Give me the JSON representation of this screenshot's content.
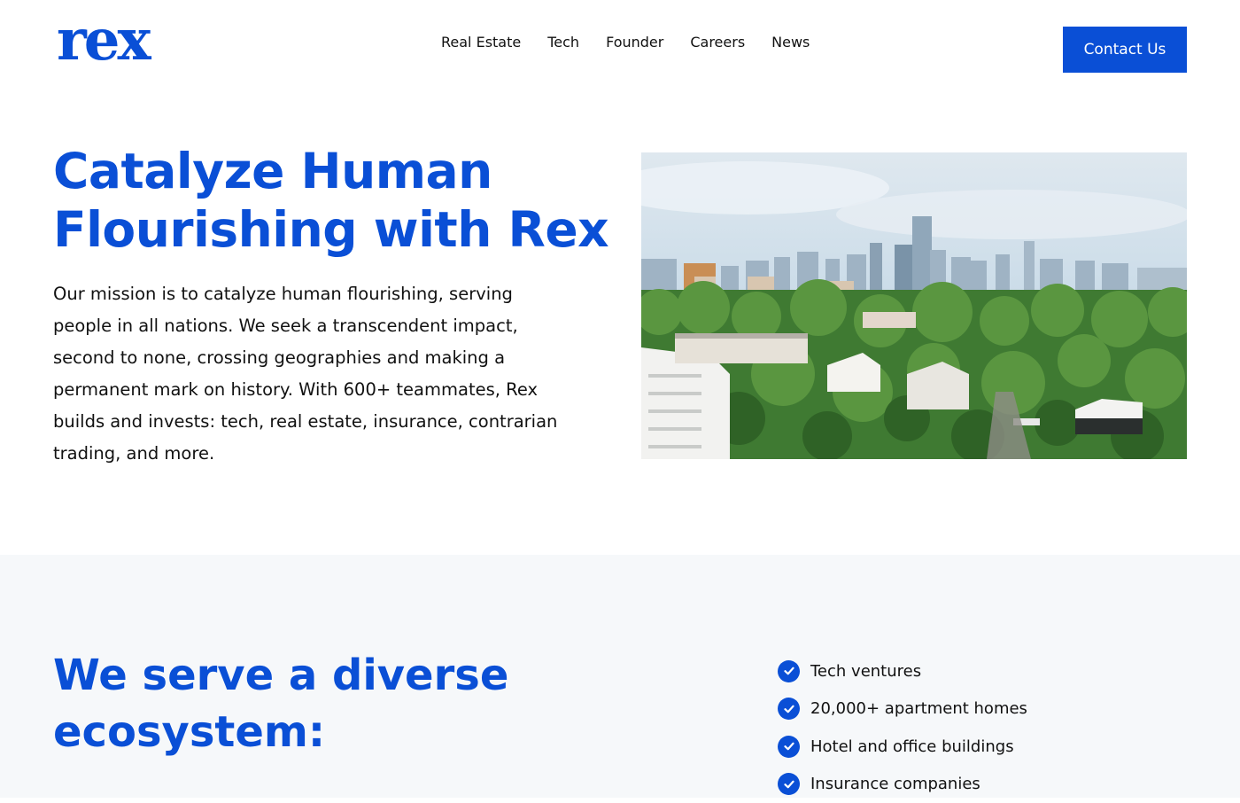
{
  "brand": {
    "logo_text": "rex",
    "color": "#0a4fd6"
  },
  "nav": {
    "items": [
      {
        "label": "Real Estate"
      },
      {
        "label": "Tech"
      },
      {
        "label": "Founder"
      },
      {
        "label": "Careers"
      },
      {
        "label": "News"
      }
    ],
    "contact_label": "Contact Us"
  },
  "hero": {
    "title_line1": "Catalyze Human",
    "title_line2": "Flourishing with Rex",
    "body": "Our mission is to catalyze human flourishing, serving people in all nations. We seek a transcendent impact, second to none, crossing geographies and making a permanent mark on history. With 600+ teammates, Rex builds and invests: tech, real estate, insurance, contrarian trading, and more.",
    "image_subject": "city-skyline-photo"
  },
  "ecosystem": {
    "title_line1": "We serve a diverse",
    "title_line2": "ecosystem:",
    "items": [
      {
        "label": "Tech ventures",
        "icon": "check-circle-icon"
      },
      {
        "label": "20,000+ apartment homes",
        "icon": "check-circle-icon"
      },
      {
        "label": "Hotel and office buildings",
        "icon": "check-circle-icon"
      },
      {
        "label": "Insurance companies",
        "icon": "check-circle-icon"
      }
    ]
  }
}
